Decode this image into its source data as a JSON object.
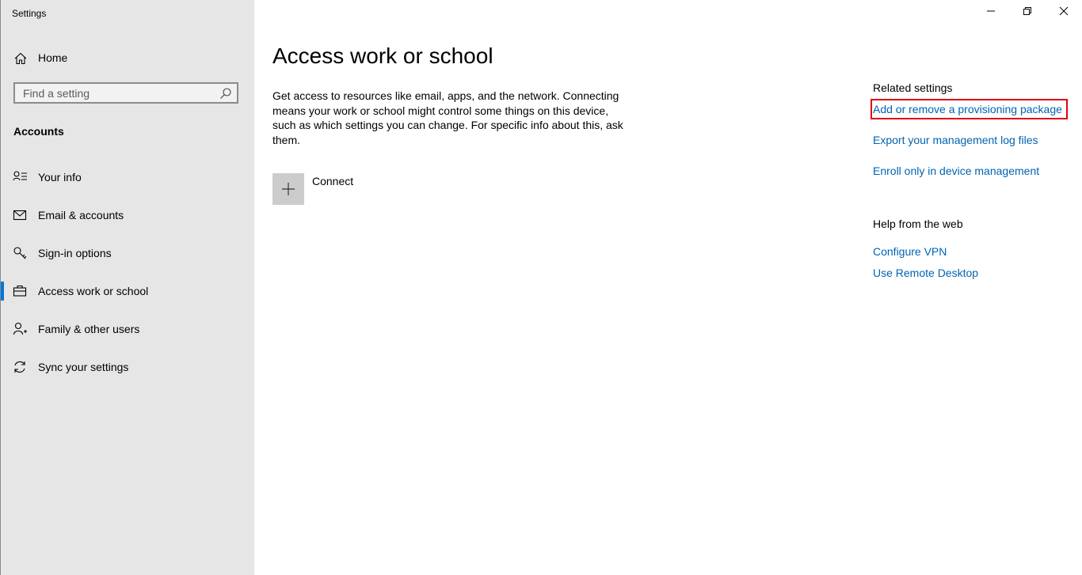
{
  "window": {
    "title": "Settings",
    "controls": [
      "minimize",
      "restore",
      "close"
    ]
  },
  "sidebar": {
    "home_label": "Home",
    "search_placeholder": "Find a setting",
    "section": "Accounts",
    "items": [
      {
        "label": "Your info",
        "icon": "person-info-icon"
      },
      {
        "label": "Email & accounts",
        "icon": "mail-icon"
      },
      {
        "label": "Sign-in options",
        "icon": "key-icon"
      },
      {
        "label": "Access work or school",
        "icon": "briefcase-icon",
        "active": true
      },
      {
        "label": "Family & other users",
        "icon": "person-add-icon"
      },
      {
        "label": "Sync your settings",
        "icon": "sync-icon"
      }
    ]
  },
  "main": {
    "title": "Access work or school",
    "description": "Get access to resources like email, apps, and the network. Connecting means your work or school might control some things on this device, such as which settings you can change. For specific info about this, ask them.",
    "connect_label": "Connect"
  },
  "related": {
    "heading": "Related settings",
    "links": [
      "Add or remove a provisioning package",
      "Export your management log files",
      "Enroll only in device management"
    ]
  },
  "help": {
    "heading": "Help from the web",
    "links": [
      "Configure VPN",
      "Use Remote Desktop"
    ]
  },
  "colors": {
    "accent": "#0078d7",
    "link": "#0063b1",
    "highlight": "#e0000f",
    "sidebar_bg": "#e6e6e6"
  }
}
